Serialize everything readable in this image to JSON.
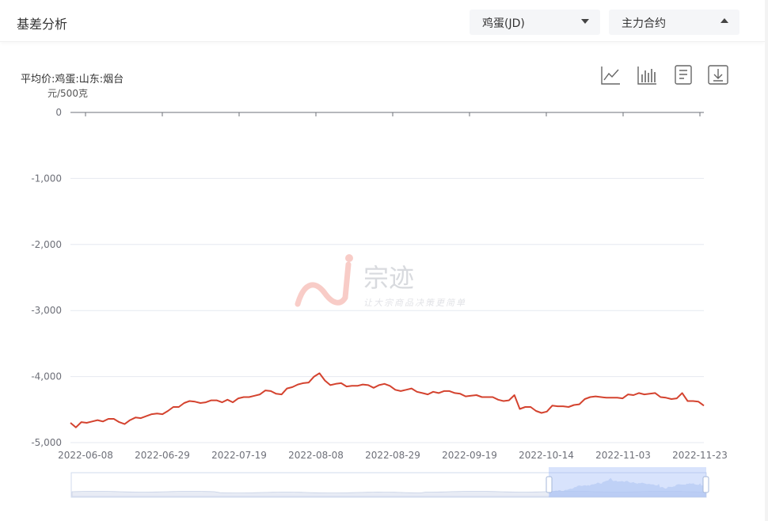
{
  "header": {
    "title": "基差分析",
    "product_select": "鸡蛋(JD)",
    "contract_select": "主力合约"
  },
  "toolbar": {
    "icons": [
      "line-chart-icon",
      "bar-chart-icon",
      "data-view-icon",
      "download-icon"
    ]
  },
  "watermark": {
    "brand": "宗迹",
    "tagline": "让大宗商品决策更简单"
  },
  "colors": {
    "line": "#d4432f",
    "grid": "#e6e9f0",
    "axis": "#6e7079",
    "watermark": "#f4a49a",
    "zoom_fill": "#dbe6fb"
  },
  "chart_data": {
    "type": "line",
    "title": "平均价:鸡蛋:山东:烟台",
    "ylabel": "元/500克",
    "ylim": [
      -5000,
      0
    ],
    "yticks": [
      0,
      -1000,
      -2000,
      -3000,
      -4000,
      -5000
    ],
    "ytick_labels": [
      "0",
      "-1,000",
      "-2,000",
      "-3,000",
      "-4,000",
      "-5,000"
    ],
    "xtick_labels": [
      "2022-06-08",
      "2022-06-29",
      "2022-07-19",
      "2022-08-08",
      "2022-08-29",
      "2022-09-19",
      "2022-10-14",
      "2022-11-03",
      "2022-11-23"
    ],
    "grid": true,
    "series": [
      {
        "values": [
          -4700,
          -4770,
          -4690,
          -4700,
          -4680,
          -4660,
          -4680,
          -4640,
          -4640,
          -4690,
          -4720,
          -4660,
          -4620,
          -4630,
          -4600,
          -4570,
          -4560,
          -4570,
          -4520,
          -4460,
          -4460,
          -4400,
          -4370,
          -4380,
          -4400,
          -4390,
          -4360,
          -4360,
          -4390,
          -4350,
          -4390,
          -4330,
          -4310,
          -4310,
          -4290,
          -4270,
          -4210,
          -4220,
          -4260,
          -4270,
          -4180,
          -4160,
          -4120,
          -4100,
          -4090,
          -4000,
          -3950,
          -4060,
          -4130,
          -4110,
          -4100,
          -4150,
          -4140,
          -4140,
          -4120,
          -4130,
          -4170,
          -4130,
          -4110,
          -4140,
          -4200,
          -4220,
          -4200,
          -4180,
          -4230,
          -4250,
          -4270,
          -4230,
          -4250,
          -4220,
          -4220,
          -4250,
          -4260,
          -4300,
          -4290,
          -4280,
          -4310,
          -4310,
          -4310,
          -4350,
          -4370,
          -4360,
          -4280,
          -4490,
          -4460,
          -4460,
          -4520,
          -4550,
          -4530,
          -4440,
          -4450,
          -4450,
          -4460,
          -4430,
          -4420,
          -4340,
          -4310,
          -4300,
          -4310,
          -4320,
          -4320,
          -4320,
          -4330,
          -4270,
          -4280,
          -4250,
          -4270,
          -4260,
          -4250,
          -4310,
          -4320,
          -4340,
          -4330,
          -4250,
          -4370,
          -4370,
          -4380,
          -4440
        ]
      }
    ]
  }
}
